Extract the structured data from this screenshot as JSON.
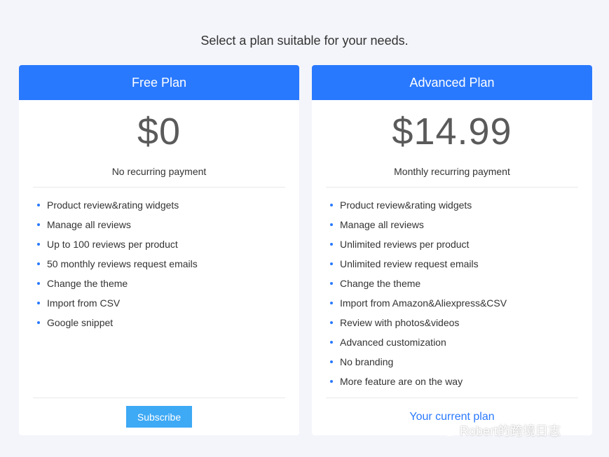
{
  "heading": "Select a plan suitable for your needs.",
  "plans": [
    {
      "name": "Free Plan",
      "price": "$0",
      "price_note": "No recurring payment",
      "features": [
        "Product review&rating widgets",
        "Manage all reviews",
        "Up to 100 reviews per product",
        "50 monthly reviews request emails",
        "Change the theme",
        "Import from CSV",
        "Google snippet"
      ],
      "action_label": "Subscribe"
    },
    {
      "name": "Advanced Plan",
      "price": "$14.99",
      "price_note": "Monthly recurring payment",
      "features": [
        "Product review&rating widgets",
        "Manage all reviews",
        "Unlimited reviews per product",
        "Unlimited review request emails",
        "Change the theme",
        "Import from Amazon&Aliexpress&CSV",
        "Review with photos&videos",
        "Advanced customization",
        "No branding",
        "More feature are on the way"
      ],
      "action_label": "Your current plan"
    }
  ],
  "watermark": "Robert的跨境日志",
  "colors": {
    "header_blue": "#2979ff",
    "button_blue": "#3ea9f5",
    "background": "#f4f5fa"
  }
}
